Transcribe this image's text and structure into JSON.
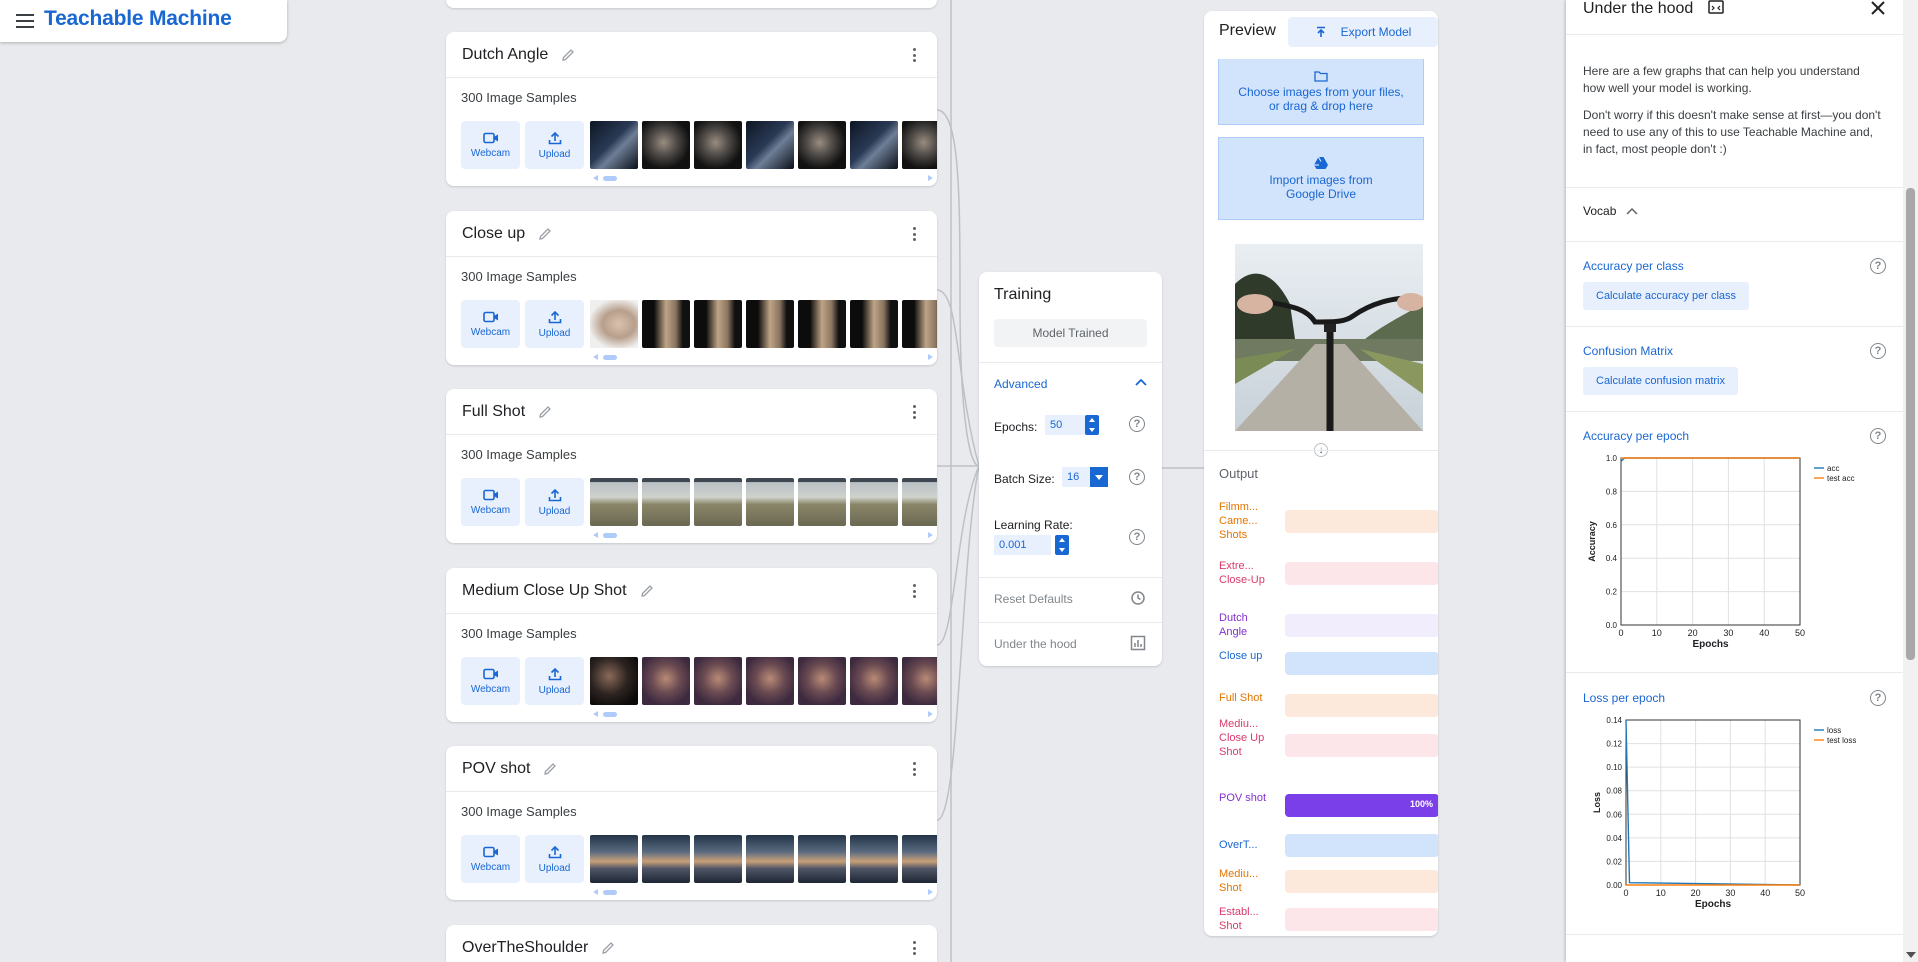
{
  "app": {
    "title": "Teachable Machine"
  },
  "classes": [
    {
      "name": "Dutch Angle",
      "samples": "300 Image Samples",
      "thumb_style": [
        "t-dark1",
        "t-dark2",
        "t-dark2",
        "t-dark1",
        "t-dark2",
        "t-dark1",
        "t-dark2"
      ]
    },
    {
      "name": "Close up",
      "samples": "300 Image Samples",
      "thumb_style": [
        "t-face",
        "t-close",
        "t-close",
        "t-close",
        "t-close",
        "t-close",
        "t-close"
      ]
    },
    {
      "name": "Full Shot",
      "samples": "300 Image Samples",
      "thumb_style": [
        "t-field",
        "t-field",
        "t-field",
        "t-field",
        "t-field",
        "t-field",
        "t-field"
      ]
    },
    {
      "name": "Medium Close Up Shot",
      "samples": "300 Image Samples",
      "thumb_style": [
        "t-medium0",
        "t-medium",
        "t-medium",
        "t-medium",
        "t-medium",
        "t-medium",
        "t-medium"
      ]
    },
    {
      "name": "POV shot",
      "samples": "300 Image Samples",
      "thumb_style": [
        "t-pov",
        "t-pov",
        "t-pov",
        "t-pov",
        "t-pov",
        "t-pov",
        "t-pov"
      ]
    },
    {
      "name": "OverTheShoulder",
      "samples": "",
      "thumb_style": []
    }
  ],
  "sample_buttons": {
    "webcam": "Webcam",
    "upload": "Upload"
  },
  "training": {
    "title": "Training",
    "status_button": "Model Trained",
    "advanced_label": "Advanced",
    "epochs_label": "Epochs:",
    "epochs_value": "50",
    "batch_label": "Batch Size:",
    "batch_value": "16",
    "lr_label": "Learning Rate:",
    "lr_value": "0.001",
    "reset_label": "Reset Defaults",
    "hood_label": "Under the hood"
  },
  "preview": {
    "title": "Preview",
    "export_label": "Export Model",
    "choose_files": "Choose images from your files, or drag & drop here",
    "import_drive": "Import images from Google Drive",
    "output_title": "Output",
    "outputs": [
      {
        "label": "Filmm... Came... Shots",
        "color": "#e37400",
        "bar": "#fde9dc",
        "value": 0
      },
      {
        "label": "Extre... Close-Up",
        "color": "#d93b6b",
        "bar": "#fde6ea",
        "value": 0
      },
      {
        "label": "Dutch Angle",
        "color": "#8430ce",
        "bar": "#f1edfc",
        "value": 0
      },
      {
        "label": "Close up",
        "color": "#1967d2",
        "bar": "#d2e3fc",
        "value": 0
      },
      {
        "label": "Full Shot",
        "color": "#e37400",
        "bar": "#fde9dc",
        "value": 0
      },
      {
        "label": "Mediu... Close Up Shot",
        "color": "#d93b6b",
        "bar": "#fde6ea",
        "value": 0
      },
      {
        "label": "POV shot",
        "color": "#8430ce",
        "bar": "#7a3fe8",
        "value": 100,
        "pct": "100%"
      },
      {
        "label": "OverT...",
        "color": "#1967d2",
        "bar": "#d2e3fc",
        "value": 0
      },
      {
        "label": "Mediu... Shot",
        "color": "#e37400",
        "bar": "#fde9dc",
        "value": 0
      },
      {
        "label": "Establ... Shot",
        "color": "#d93b6b",
        "bar": "#fde6ea",
        "value": 0
      }
    ]
  },
  "hood": {
    "title": "Under the hood",
    "intro1": "Here are a few graphs that can help you understand how well your model is working.",
    "intro2": "Don't worry if this doesn't make sense at first—you don't need to use any of this to use Teachable Machine and, in fact, most people don't :)",
    "vocab": "Vocab",
    "acc_class_title": "Accuracy per class",
    "acc_class_btn": "Calculate accuracy per class",
    "confusion_title": "Confusion Matrix",
    "confusion_btn": "Calculate confusion matrix",
    "acc_epoch_title": "Accuracy per epoch",
    "loss_epoch_title": "Loss per epoch"
  },
  "chart_data": [
    {
      "type": "line",
      "title": "Accuracy per epoch",
      "xlabel": "Epochs",
      "ylabel": "Accuracy",
      "xlim": [
        0,
        50
      ],
      "ylim": [
        0,
        1.0
      ],
      "xticks": [
        "0",
        "10",
        "20",
        "30",
        "40",
        "50"
      ],
      "yticks": [
        "0.0",
        "0.2",
        "0.4",
        "0.6",
        "0.8",
        "1.0"
      ],
      "legend": "top-right",
      "series": [
        {
          "name": "acc",
          "color": "#1f77b4",
          "x": [
            0,
            1,
            50
          ],
          "values": [
            0.98,
            1.0,
            1.0
          ]
        },
        {
          "name": "test acc",
          "color": "#ff7f0e",
          "x": [
            0,
            50
          ],
          "values": [
            1.0,
            1.0
          ]
        }
      ]
    },
    {
      "type": "line",
      "title": "Loss per epoch",
      "xlabel": "Epochs",
      "ylabel": "Loss",
      "xlim": [
        0,
        50
      ],
      "ylim": [
        0,
        0.14
      ],
      "xticks": [
        "0",
        "10",
        "20",
        "30",
        "40",
        "50"
      ],
      "yticks": [
        "0.00",
        "0.02",
        "0.04",
        "0.06",
        "0.08",
        "0.10",
        "0.12",
        "0.14"
      ],
      "legend": "top-right",
      "series": [
        {
          "name": "loss",
          "color": "#1f77b4",
          "x": [
            0,
            1,
            50
          ],
          "values": [
            0.14,
            0.002,
            0.0
          ]
        },
        {
          "name": "test loss",
          "color": "#ff7f0e",
          "x": [
            0,
            50
          ],
          "values": [
            0.0,
            0.0
          ]
        }
      ]
    }
  ]
}
